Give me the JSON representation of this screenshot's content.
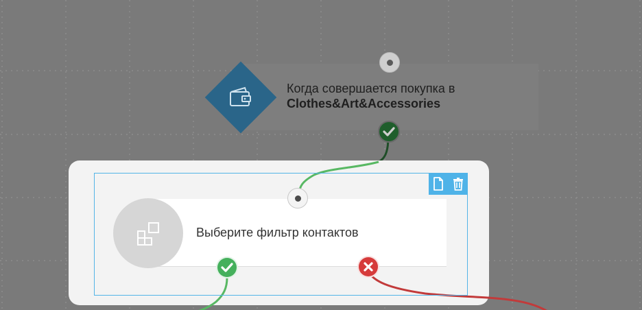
{
  "trigger": {
    "text_line1": "Когда совершается покупка в",
    "text_line2": "Clothes&Art&Accessories",
    "icon": "wallet-icon",
    "color": "#2a6589"
  },
  "filter_node": {
    "label": "Выберите фильтр контактов",
    "icon": "filter-blocks-icon"
  },
  "toolbar": {
    "copy_icon": "document-icon",
    "delete_icon": "trash-icon"
  },
  "branches": {
    "yes_icon": "check-icon",
    "no_icon": "close-icon"
  },
  "colors": {
    "accent": "#4fb3e8",
    "success": "#45b05c",
    "danger": "#d63b3b",
    "canvas": "#7a7a7a"
  }
}
